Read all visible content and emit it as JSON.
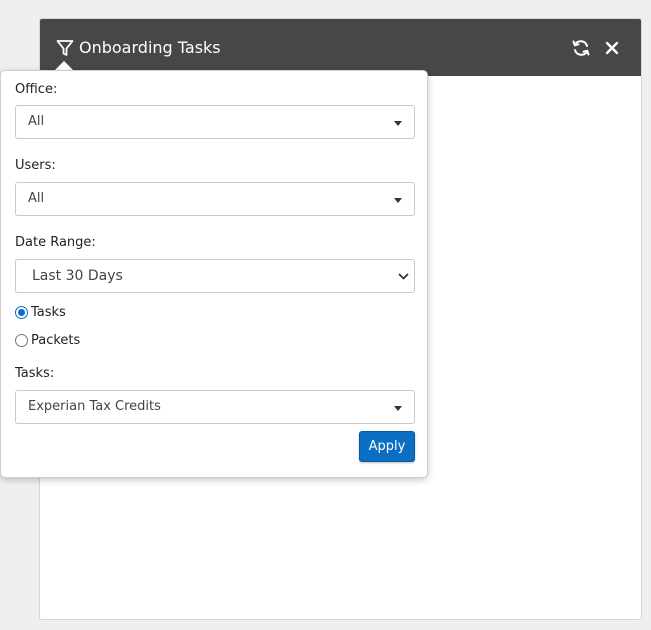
{
  "widget": {
    "title": "Onboarding Tasks",
    "header_color": "#474747",
    "icons": {
      "filter": "filter-icon",
      "refresh": "refresh-icon",
      "close": "close-icon"
    }
  },
  "filters": {
    "office": {
      "label": "Office:",
      "value": "All"
    },
    "users": {
      "label": "Users:",
      "value": "All"
    },
    "date_range": {
      "label": "Date Range:",
      "value": "Last 30 Days"
    },
    "mode": {
      "options": [
        {
          "label": "Tasks",
          "checked": true
        },
        {
          "label": "Packets",
          "checked": false
        }
      ]
    },
    "tasks": {
      "label": "Tasks:",
      "value": "Experian Tax Credits"
    },
    "apply_label": "Apply",
    "accent_color": "#0a6fc2"
  }
}
